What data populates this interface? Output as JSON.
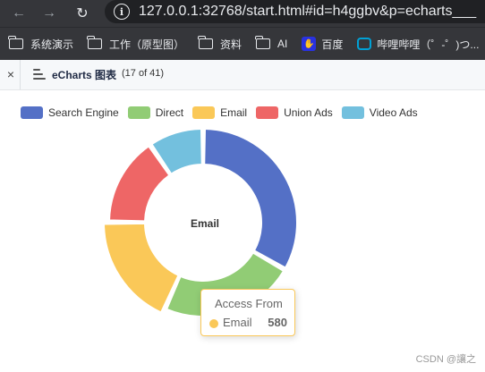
{
  "browser": {
    "url": "127.0.0.1:32768/start.html#id=h4ggbv&p=echarts___",
    "bookmarks": [
      "系统演示",
      "工作（原型图）",
      "资料",
      "AI",
      "百度",
      "哔哩哔哩（゜-゜)つ..."
    ]
  },
  "tab": {
    "close": "×",
    "title": "eCharts 图表",
    "count": "(17 of 41)"
  },
  "chart_data": {
    "type": "pie",
    "title": "",
    "legend": [
      "Search Engine",
      "Direct",
      "Email",
      "Union Ads",
      "Video Ads"
    ],
    "legend_position": "top-left",
    "colors": [
      "#5470c6",
      "#91cc75",
      "#fac858",
      "#ee6666",
      "#73c0de"
    ],
    "values": [
      1048,
      735,
      580,
      484,
      300
    ],
    "center_label": "Email"
  },
  "tooltip": {
    "title": "Access From",
    "name": "Email",
    "value": "580"
  },
  "watermark": "CSDN @讓之"
}
